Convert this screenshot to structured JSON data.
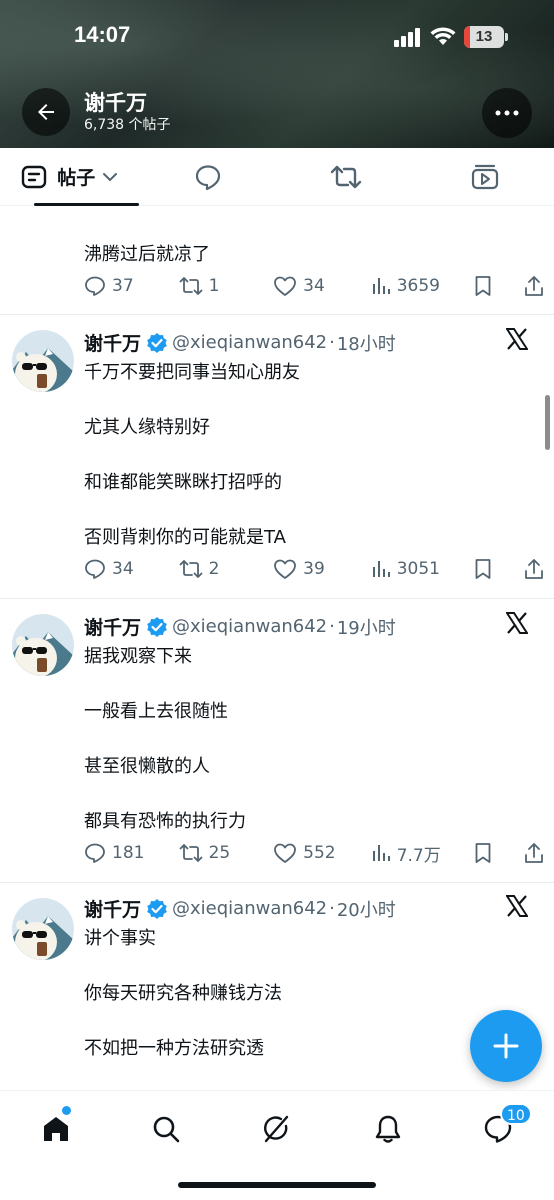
{
  "status_bar": {
    "time": "14:07",
    "battery": "13"
  },
  "profile_header": {
    "name": "谢千万",
    "post_count": "6,738 个帖子"
  },
  "tabs": {
    "posts_label": "帖子"
  },
  "posts": [
    {
      "partial": true,
      "text": [
        "沸腾过后就凉了"
      ],
      "reply_count": "37",
      "repost_count": "1",
      "like_count": "34",
      "view_count": "3659"
    },
    {
      "author": "谢千万",
      "handle": "@xieqianwan642",
      "time": "18小时",
      "text": [
        "千万不要把同事当知心朋友",
        "尤其人缘特别好",
        "和谁都能笑眯眯打招呼的",
        "否则背刺你的可能就是TA"
      ],
      "reply_count": "34",
      "repost_count": "2",
      "like_count": "39",
      "view_count": "3051"
    },
    {
      "author": "谢千万",
      "handle": "@xieqianwan642",
      "time": "19小时",
      "text": [
        "据我观察下来",
        "一般看上去很随性",
        "甚至很懒散的人",
        "都具有恐怖的执行力"
      ],
      "reply_count": "181",
      "repost_count": "25",
      "like_count": "552",
      "view_count": "7.7万"
    },
    {
      "author": "谢千万",
      "handle": "@xieqianwan642",
      "time": "20小时",
      "text": [
        "讲个事实",
        "你每天研究各种赚钱方法",
        "不如把一种方法研究透"
      ]
    }
  ],
  "bottom_nav": {
    "messages_badge": "10"
  },
  "colors": {
    "accent": "#1d9bf0",
    "verified": "#1d9bf0",
    "text_secondary": "#536471"
  }
}
